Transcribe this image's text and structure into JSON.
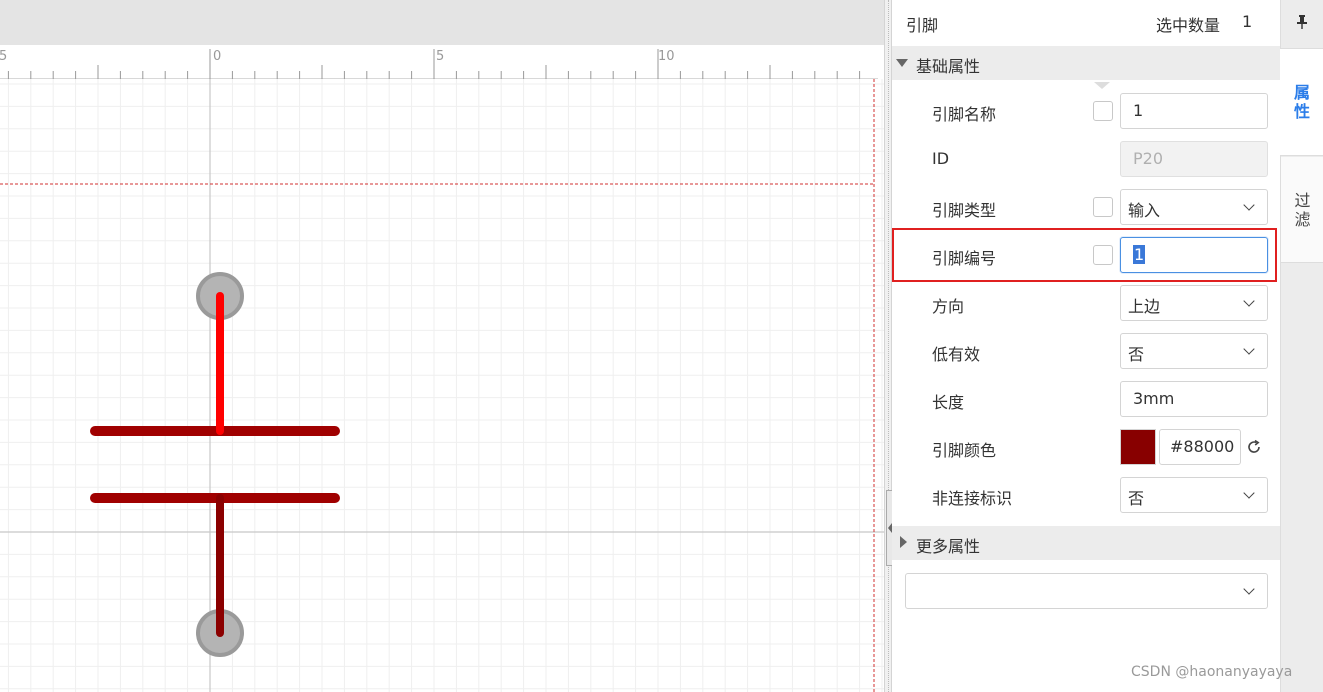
{
  "ruler": {
    "labels": [
      "5",
      "0",
      "5",
      "10"
    ]
  },
  "panel": {
    "title": "引脚",
    "selected_label": "选中数量",
    "selected_count": "1",
    "sections": {
      "basic": "基础属性",
      "more": "更多属性"
    },
    "properties": {
      "pin_name": {
        "label": "引脚名称",
        "value": "1"
      },
      "id": {
        "label": "ID",
        "value": "P20"
      },
      "pin_type": {
        "label": "引脚类型",
        "value": "输入"
      },
      "pin_number": {
        "label": "引脚编号",
        "value": "1"
      },
      "direction": {
        "label": "方向",
        "value": "上边"
      },
      "active_low": {
        "label": "低有效",
        "value": "否"
      },
      "length": {
        "label": "长度",
        "value": "3mm"
      },
      "pin_color": {
        "label": "引脚颜色",
        "value": "#88000",
        "swatch": "#880000"
      },
      "no_connect": {
        "label": "非连接标识",
        "value": "否"
      }
    },
    "extra_select": {
      "value": ""
    }
  },
  "side_tabs": {
    "properties": "属\n性",
    "filter": "过\n滤"
  },
  "watermark": "CSDN @haonanyayaya",
  "colors": {
    "accent": "#2b7de9",
    "pin_red": "#ff0000",
    "plate_dark_red": "#a00000",
    "highlight": "#e02020"
  }
}
